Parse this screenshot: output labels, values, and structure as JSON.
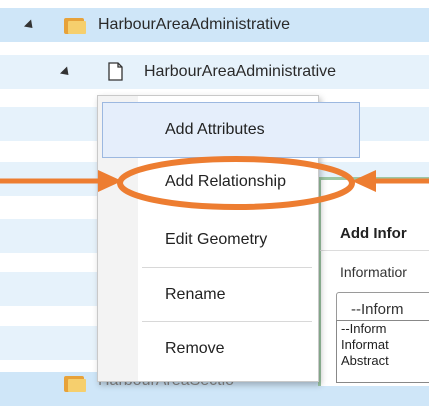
{
  "tree": {
    "root_label": "HarbourAreaAdministrative",
    "child_label": "HarbourAreaAdministrative",
    "bottom_label": "HarbourAreaSectio"
  },
  "context_menu": {
    "items": [
      {
        "label": "Add Attributes"
      },
      {
        "label": "Add Relationship"
      },
      {
        "label": "Edit Geometry"
      },
      {
        "label": "Rename"
      },
      {
        "label": "Remove"
      }
    ]
  },
  "dialog": {
    "title": "Add Infor",
    "label": "Informatior",
    "select_value": "--Inform",
    "options": [
      "--Inform",
      "Informat",
      "Abstract"
    ]
  },
  "colors": {
    "annotation": "#ed7d31",
    "tree_selected": "#cfe6f8"
  }
}
